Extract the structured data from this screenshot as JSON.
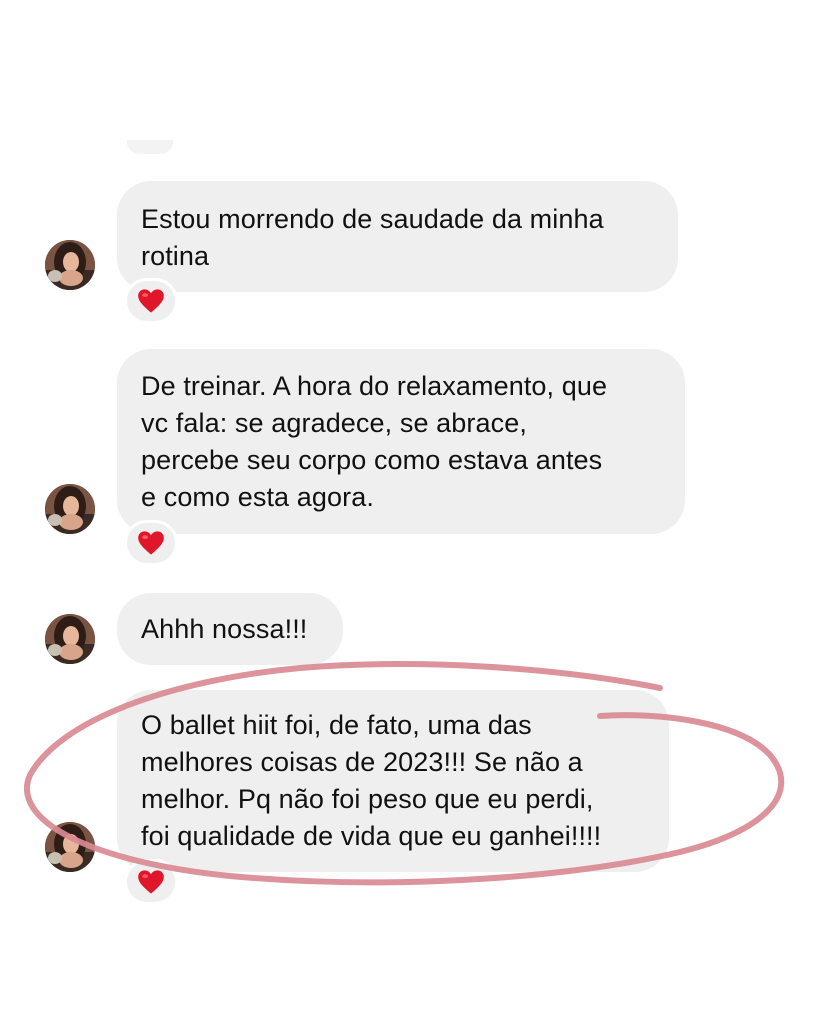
{
  "conversation": {
    "messages": [
      {
        "lines": [
          "Estou morrendo de saudade da minha",
          "rotina"
        ],
        "reaction": "heart"
      },
      {
        "lines": [
          "De treinar. A hora do relaxamento, que",
          "vc fala: se agradece, se abrace,",
          "percebe seu corpo como estava antes",
          "e como esta agora."
        ],
        "reaction": "heart"
      },
      {
        "lines": [
          "Ahhh nossa!!!"
        ],
        "reaction": null
      },
      {
        "lines": [
          "O ballet hiit foi, de fato, uma das",
          "melhores coisas de 2023!!! Se não a",
          "melhor. Pq não foi peso que eu perdi,",
          "foi qualidade de vida que eu ganhei!!!!"
        ],
        "reaction": "heart"
      }
    ]
  },
  "icons": {
    "reaction": "heart-icon",
    "avatar": "profile-photo"
  },
  "colors": {
    "bubble": "#efefef",
    "heart": "#e0162b",
    "highlight_ring": "#d98a94",
    "text": "#111111",
    "background": "#ffffff"
  }
}
